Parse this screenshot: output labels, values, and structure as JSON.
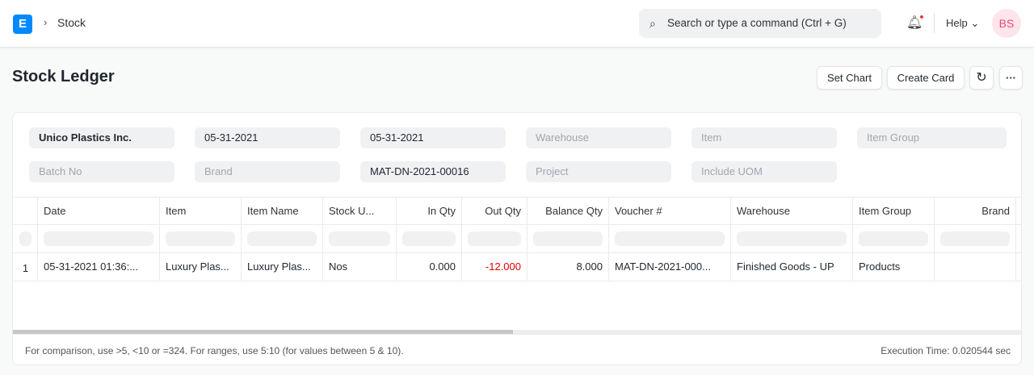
{
  "navbar": {
    "logo": "E",
    "breadcrumb": "Stock",
    "search_placeholder": "Search or type a command (Ctrl + G)",
    "help": "Help",
    "avatar": "BS"
  },
  "page": {
    "title": "Stock Ledger",
    "buttons": {
      "set_chart": "Set Chart",
      "create_card": "Create Card",
      "refresh": "↻",
      "more": "···"
    }
  },
  "filters": {
    "company": "Unico Plastics Inc.",
    "from_date": "05-31-2021",
    "to_date": "05-31-2021",
    "warehouse": "Warehouse",
    "item": "Item",
    "item_group": "Item Group",
    "batch_no": "Batch No",
    "brand": "Brand",
    "voucher_no": "MAT-DN-2021-00016",
    "project": "Project",
    "include_uom": "Include UOM"
  },
  "table": {
    "columns": [
      "Date",
      "Item",
      "Item Name",
      "Stock U...",
      "In Qty",
      "Out Qty",
      "Balance Qty",
      "Voucher #",
      "Warehouse",
      "Item Group",
      "Brand"
    ],
    "rows": [
      {
        "n": "1",
        "date": "05-31-2021 01:36:...",
        "item": "Luxury Plas...",
        "item_name": "Luxury Plas...",
        "uom": "Nos",
        "in_qty": "0.000",
        "out_qty": "-12.000",
        "balance": "8.000",
        "voucher": "MAT-DN-2021-000...",
        "warehouse": "Finished Goods - UP",
        "item_group": "Products",
        "brand": ""
      }
    ]
  },
  "footer": {
    "hint": "For comparison, use >5, <10 or =324. For ranges, use 5:10 (for values between 5 & 10).",
    "exec_time": "Execution Time: 0.020544 sec"
  },
  "colors": {
    "accent": "#0089ff",
    "negative": "#e00000"
  }
}
